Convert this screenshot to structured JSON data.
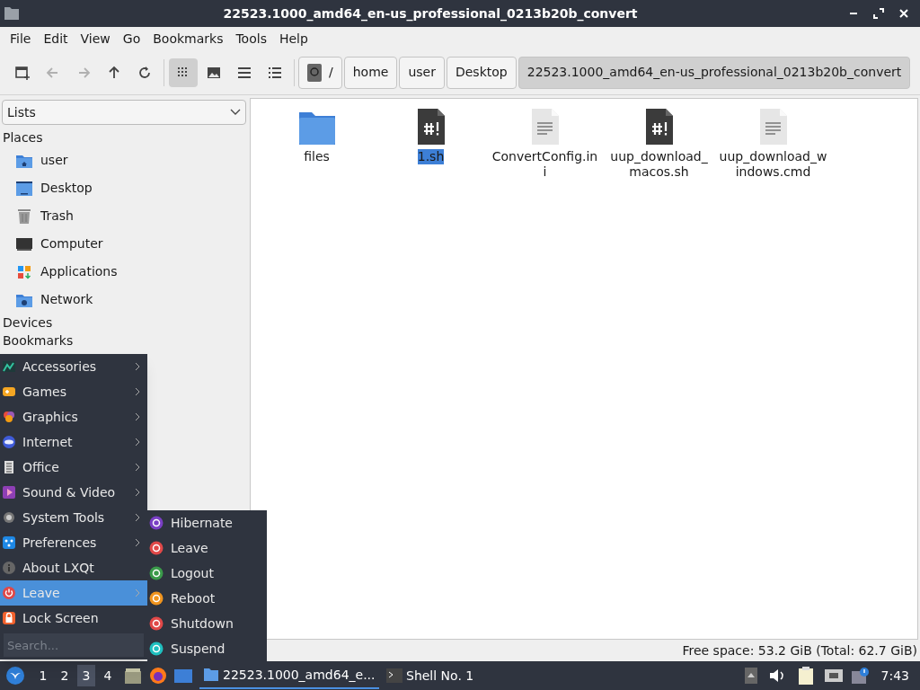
{
  "window": {
    "title": "22523.1000_amd64_en-us_professional_0213b20b_convert"
  },
  "menu_bar": [
    "File",
    "Edit",
    "View",
    "Go",
    "Bookmarks",
    "Tools",
    "Help"
  ],
  "toolbar": [
    {
      "kind": "new-tab",
      "disabled": false,
      "selected": false
    },
    {
      "kind": "back",
      "disabled": true,
      "selected": false
    },
    {
      "kind": "forward",
      "disabled": true,
      "selected": false
    },
    {
      "kind": "up",
      "disabled": false,
      "selected": false
    },
    {
      "kind": "reload",
      "disabled": false,
      "selected": false
    },
    {
      "kind": "icons",
      "disabled": false,
      "selected": true
    },
    {
      "kind": "thumbnails",
      "disabled": false,
      "selected": false
    },
    {
      "kind": "compact",
      "disabled": false,
      "selected": false
    },
    {
      "kind": "details",
      "disabled": false,
      "selected": false
    }
  ],
  "path_bar": [
    {
      "label": "/",
      "selected": false
    },
    {
      "label": "home",
      "selected": false
    },
    {
      "label": "user",
      "selected": false
    },
    {
      "label": "Desktop",
      "selected": false
    },
    {
      "label": "22523.1000_amd64_en-us_professional_0213b20b_convert",
      "selected": true
    }
  ],
  "sidebar": {
    "view_select": "Lists",
    "sections": [
      {
        "title": "Places",
        "items": [
          {
            "label": "user",
            "kind": "home"
          },
          {
            "label": "Desktop",
            "kind": "desktop"
          },
          {
            "label": "Trash",
            "kind": "trash"
          },
          {
            "label": "Computer",
            "kind": "computer"
          },
          {
            "label": "Applications",
            "kind": "apps"
          },
          {
            "label": "Network",
            "kind": "network"
          }
        ]
      },
      {
        "title": "Devices"
      },
      {
        "title": "Bookmarks"
      }
    ]
  },
  "files": [
    {
      "name": "files",
      "kind": "folder",
      "selected": false
    },
    {
      "name": "1.sh",
      "kind": "script",
      "selected": true
    },
    {
      "name": "ConvertConfig.ini",
      "kind": "text",
      "selected": false
    },
    {
      "name": "uup_download_macos.sh",
      "kind": "script",
      "selected": false
    },
    {
      "name": "uup_download_windows.cmd",
      "kind": "text",
      "selected": false
    }
  ],
  "status_bar": "Free space: 53.2 GiB (Total: 62.7 GiB)",
  "app_menu": {
    "items": [
      {
        "label": "Accessories",
        "kind": "accessories",
        "submenu": true,
        "selected": false
      },
      {
        "label": "Games",
        "kind": "games",
        "submenu": true,
        "selected": false
      },
      {
        "label": "Graphics",
        "kind": "graphics",
        "submenu": true,
        "selected": false
      },
      {
        "label": "Internet",
        "kind": "internet",
        "submenu": true,
        "selected": false
      },
      {
        "label": "Office",
        "kind": "office",
        "submenu": true,
        "selected": false
      },
      {
        "label": "Sound & Video",
        "kind": "media",
        "submenu": true,
        "selected": false
      },
      {
        "label": "System Tools",
        "kind": "system",
        "submenu": true,
        "selected": false
      },
      {
        "label": "Preferences",
        "kind": "prefs",
        "submenu": true,
        "selected": false
      },
      {
        "label": "About LXQt",
        "kind": "about",
        "submenu": false,
        "selected": false
      },
      {
        "label": "Leave",
        "kind": "leave",
        "submenu": true,
        "selected": true
      },
      {
        "label": "Lock Screen",
        "kind": "lock",
        "submenu": false,
        "selected": false
      }
    ],
    "search_placeholder": "Search...",
    "submenu": [
      {
        "label": "Hibernate",
        "color": "#7a3fc4"
      },
      {
        "label": "Leave",
        "color": "#e04848"
      },
      {
        "label": "Logout",
        "color": "#3a9a4a"
      },
      {
        "label": "Reboot",
        "color": "#f0941e"
      },
      {
        "label": "Shutdown",
        "color": "#e04848"
      },
      {
        "label": "Suspend",
        "color": "#1fbfbf"
      }
    ]
  },
  "taskbar": {
    "desktops": [
      {
        "label": "1",
        "selected": false
      },
      {
        "label": "2",
        "selected": false
      },
      {
        "label": "3",
        "selected": true
      },
      {
        "label": "4",
        "selected": false
      }
    ],
    "tasks": [
      {
        "label": "22523.1000_amd64_e...",
        "kind": "folder",
        "selected": true
      },
      {
        "label": "Shell No. 1",
        "kind": "terminal",
        "selected": false
      }
    ],
    "clock": "7:43"
  }
}
